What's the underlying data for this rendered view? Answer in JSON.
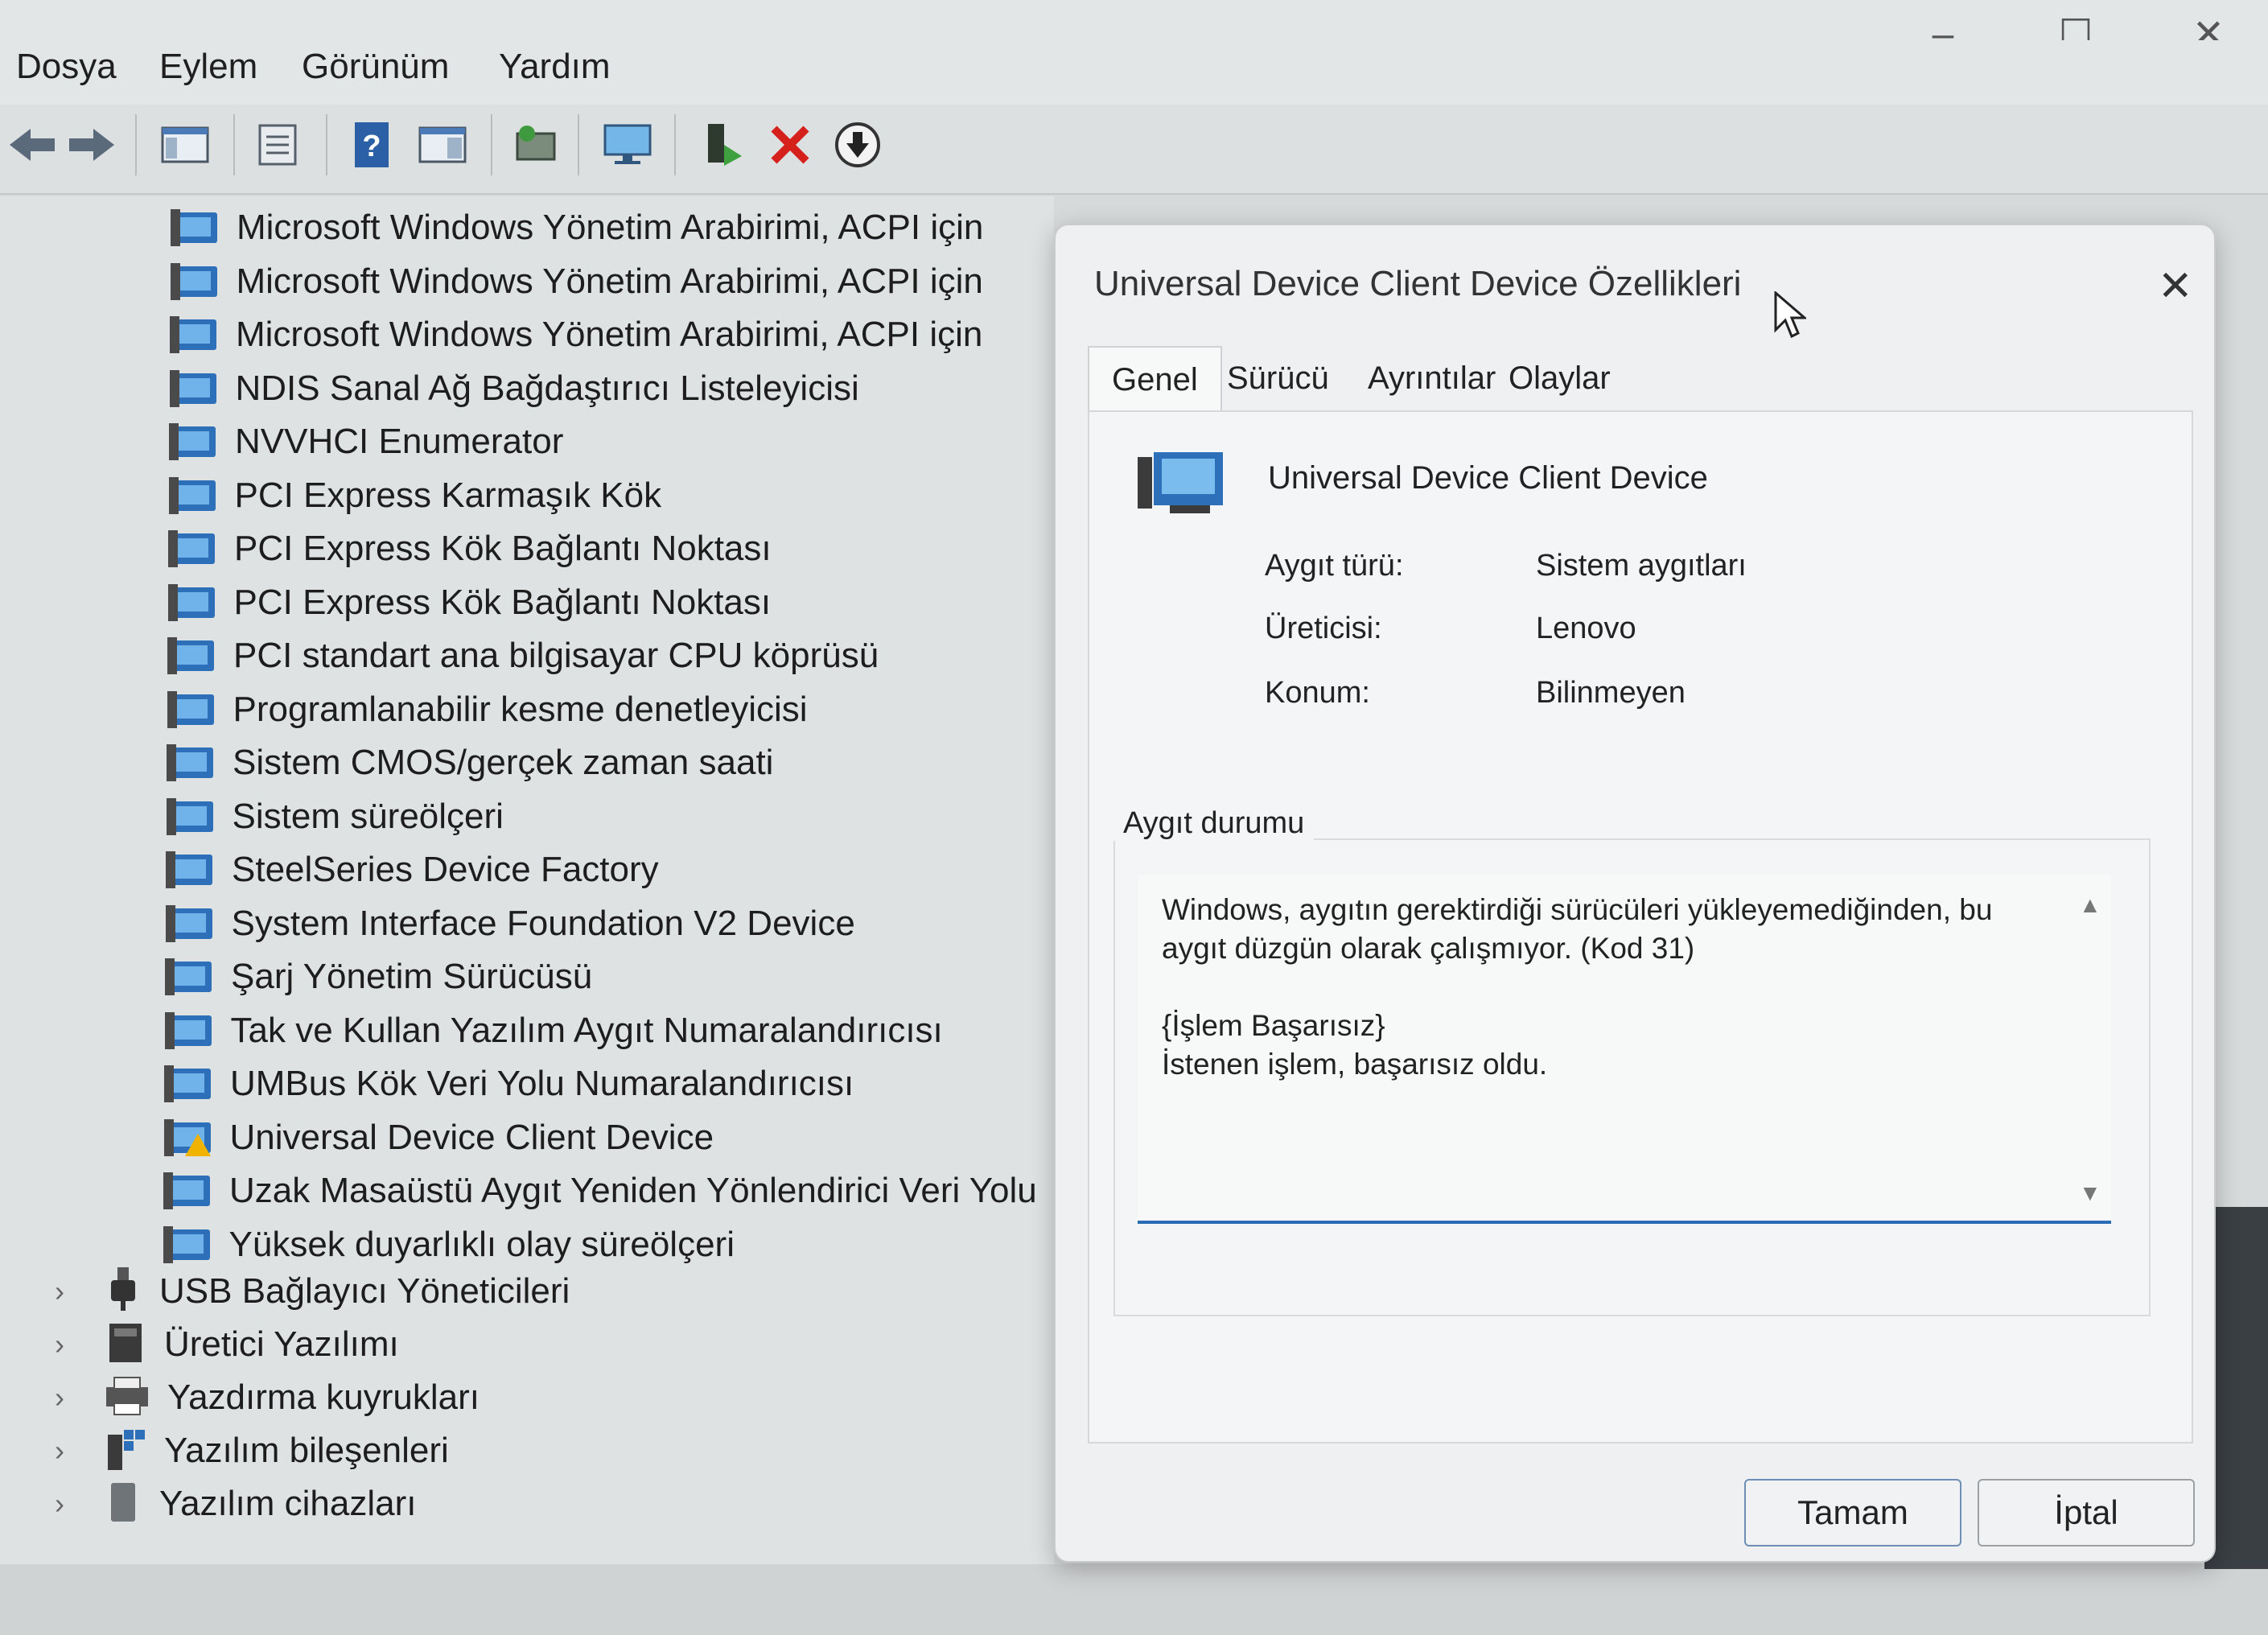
{
  "window": {
    "minimize_icon": "minimize-icon",
    "maximize_icon": "maximize-icon",
    "close_icon": "close-icon"
  },
  "menu": {
    "items": [
      "Dosya",
      "Eylem",
      "Görünüm",
      "Yardım"
    ]
  },
  "toolbar": {
    "icons": [
      "back-icon",
      "forward-icon",
      "console-tree-icon",
      "properties-icon",
      "help-icon",
      "action-pane-icon",
      "scan-changes-icon",
      "display-device-icon",
      "update-driver-icon",
      "uninstall-icon",
      "disable-device-icon"
    ]
  },
  "tree": {
    "devices": [
      "Microsoft Windows Yönetim Arabirimi, ACPI için",
      "Microsoft Windows Yönetim Arabirimi, ACPI için",
      "Microsoft Windows Yönetim Arabirimi, ACPI için",
      "NDIS Sanal Ağ Bağdaştırıcı Listeleyicisi",
      "NVVHCI Enumerator",
      "PCI Express Karmaşık Kök",
      "PCI Express Kök Bağlantı Noktası",
      "PCI Express Kök Bağlantı Noktası",
      "PCI standart ana bilgisayar CPU köprüsü",
      "Programlanabilir kesme denetleyicisi",
      "Sistem CMOS/gerçek zaman saati",
      "Sistem süreölçeri",
      "SteelSeries Device Factory",
      "System Interface Foundation V2 Device",
      "Şarj Yönetim Sürücüsü",
      "Tak ve Kullan Yazılım Aygıt Numaralandırıcısı",
      "UMBus Kök Veri Yolu Numaralandırıcısı",
      "Universal Device Client Device",
      "Uzak Masaüstü Aygıt Yeniden Yönlendirici Veri Yolu",
      "Yüksek duyarlıklı olay süreölçeri"
    ],
    "categories": [
      {
        "label": "USB Bağlayıcı Yöneticileri",
        "icon": "usb-icon"
      },
      {
        "label": "Üretici Yazılımı",
        "icon": "firmware-icon"
      },
      {
        "label": "Yazdırma kuyrukları",
        "icon": "printer-icon"
      },
      {
        "label": "Yazılım bileşenleri",
        "icon": "software-component-icon"
      },
      {
        "label": "Yazılım cihazları",
        "icon": "software-device-icon"
      }
    ],
    "expand_glyph": "›"
  },
  "dialog": {
    "title": "Universal Device Client Device Özellikleri",
    "tabs": [
      "Genel",
      "Sürücü",
      "Ayrıntılar",
      "Olaylar"
    ],
    "device_name": "Universal Device Client Device",
    "props": [
      {
        "label": "Aygıt türü:",
        "value": "Sistem aygıtları"
      },
      {
        "label": "Üreticisi:",
        "value": "Lenovo"
      },
      {
        "label": "Konum:",
        "value": "Bilinmeyen"
      }
    ],
    "status_group_label": "Aygıt durumu",
    "status_text": "Windows, aygıtın gerektirdiği sürücüleri yükleyemediğinden, bu aygıt düzgün olarak çalışmıyor. (Kod 31)\n\n{İşlem Başarısız}\nİstenen işlem, başarısız oldu.",
    "ok_label": "Tamam",
    "cancel_label": "İptal"
  }
}
